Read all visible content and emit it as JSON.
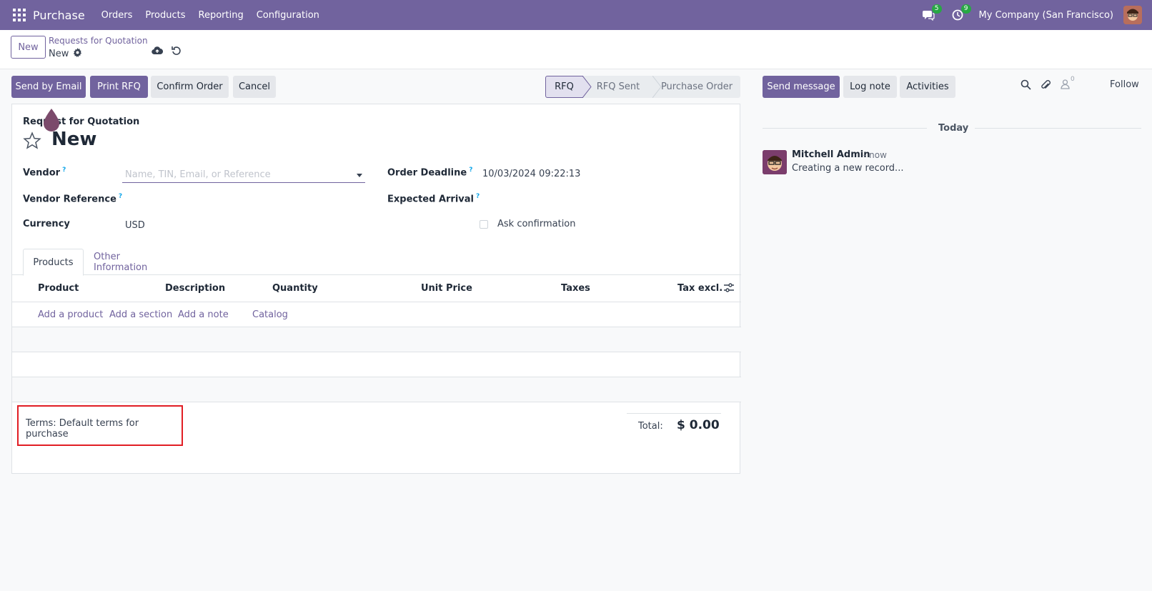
{
  "navbar": {
    "app_name": "Purchase",
    "menu": [
      "Orders",
      "Products",
      "Reporting",
      "Configuration"
    ],
    "messages_badge": "5",
    "activities_badge": "9",
    "company": "My Company (San Francisco)"
  },
  "control": {
    "new_label": "New",
    "breadcrumb_parent": "Requests for Quotation",
    "breadcrumb_current": "New"
  },
  "actions": {
    "send_email": "Send by Email",
    "print_rfq": "Print RFQ",
    "confirm": "Confirm Order",
    "cancel": "Cancel"
  },
  "statusbar": {
    "steps": [
      "RFQ",
      "RFQ Sent",
      "Purchase Order"
    ],
    "active": "RFQ"
  },
  "form": {
    "subtitle": "Request for Quotation",
    "title": "New",
    "vendor_label": "Vendor",
    "vendor_placeholder": "Name, TIN, Email, or Reference",
    "vendor_reference_label": "Vendor Reference",
    "currency_label": "Currency",
    "currency_value": "USD",
    "order_deadline_label": "Order Deadline",
    "order_deadline_value": "10/03/2024 09:22:13",
    "expected_arrival_label": "Expected Arrival",
    "ask_confirmation_label": "Ask confirmation",
    "help_mark": "?"
  },
  "tabs": {
    "products": "Products",
    "other": "Other Information"
  },
  "table": {
    "columns": [
      "Product",
      "Description",
      "Quantity",
      "Unit Price",
      "Taxes",
      "Tax excl."
    ],
    "add_product": "Add a product",
    "add_section": "Add a section",
    "add_note": "Add a note",
    "catalog": "Catalog"
  },
  "footer": {
    "terms": "Terms: Default terms for purchase",
    "total_label": "Total:",
    "total_value": "$ 0.00"
  },
  "chatter": {
    "send_message": "Send message",
    "log_note": "Log note",
    "activities": "Activities",
    "followers_count": "0",
    "follow": "Follow",
    "date_separator": "Today",
    "message": {
      "author": "Mitchell Admin",
      "time": "- now",
      "body": "Creating a new record..."
    }
  },
  "colors": {
    "brand": "#71639e",
    "highlight_box": "#e11d24",
    "badge": "#28a745"
  }
}
